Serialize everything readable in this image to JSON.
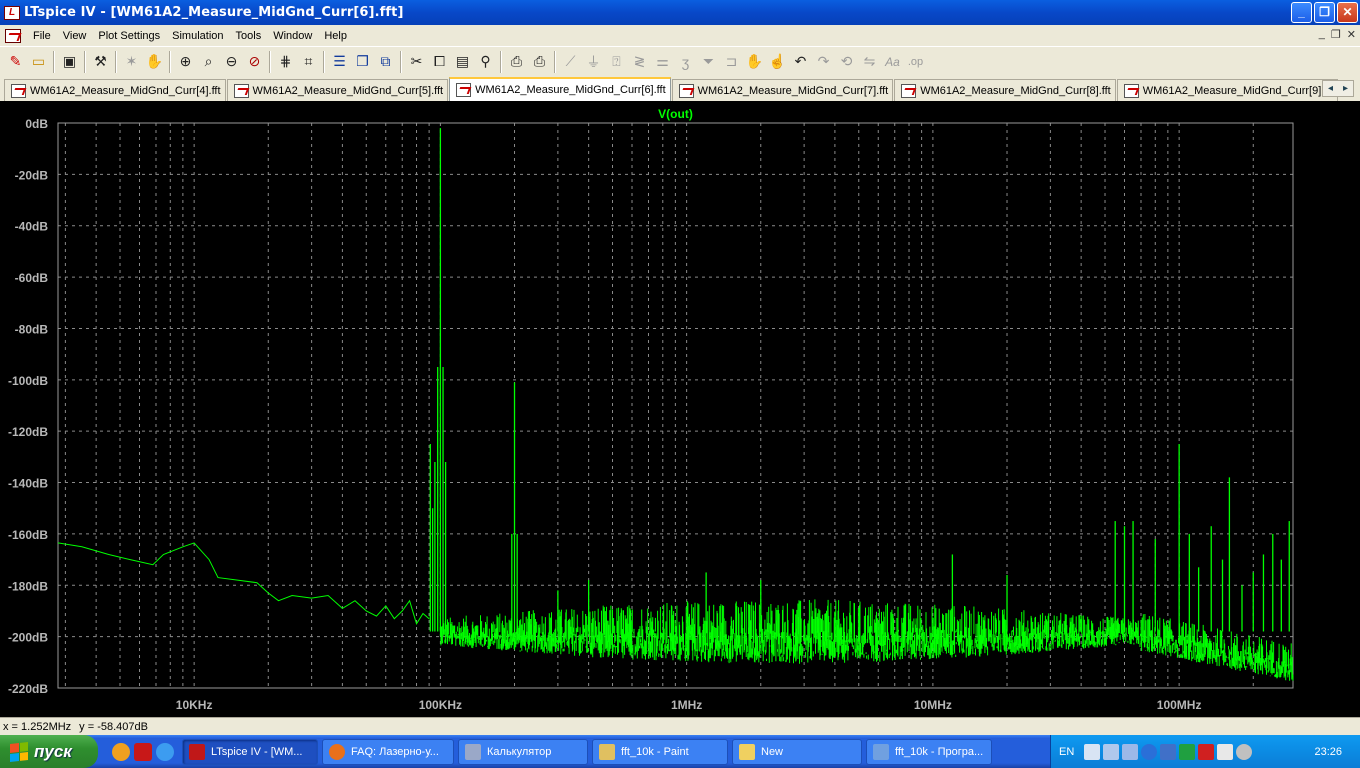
{
  "window": {
    "title": "LTspice IV - [WM61A2_Measure_MidGnd_Curr[6].fft]",
    "app_icon_glyph": "L",
    "buttons": {
      "minimize": "_",
      "restore": "❐",
      "close": "✕"
    }
  },
  "menu": {
    "items": [
      "File",
      "View",
      "Plot Settings",
      "Simulation",
      "Tools",
      "Window",
      "Help"
    ],
    "mdi_buttons": [
      "_",
      "❐",
      "✕"
    ]
  },
  "toolbar": {
    "icons": [
      "new-schematic-icon",
      "open-icon",
      "save-icon",
      "control-panel-icon",
      "run-icon",
      "halt-icon",
      "zoom-in-icon",
      "zoom-box-icon",
      "zoom-out-icon",
      "zoom-cancel-icon",
      "autorange-icon",
      "fit-icon",
      "tile-horizontal-icon",
      "cascade-icon",
      "tile-vertical-icon",
      "cut-icon",
      "copy-icon",
      "paste-icon",
      "find-icon",
      "print-preview-icon",
      "print-icon",
      "wire-icon",
      "ground-icon",
      "label-icon",
      "resistor-icon",
      "capacitor-icon",
      "inductor-icon",
      "diode-icon",
      "component-icon",
      "move-icon",
      "drag-icon",
      "undo-icon",
      "redo-icon",
      "rotate-icon",
      "mirror-icon",
      "text-icon",
      "spice-directive-icon"
    ]
  },
  "tabs": [
    {
      "label": "WM61A2_Measure_MidGnd_Curr[4].fft",
      "active": false
    },
    {
      "label": "WM61A2_Measure_MidGnd_Curr[5].fft",
      "active": false
    },
    {
      "label": "WM61A2_Measure_MidGnd_Curr[6].fft",
      "active": true
    },
    {
      "label": "WM61A2_Measure_MidGnd_Curr[7].fft",
      "active": false
    },
    {
      "label": "WM61A2_Measure_MidGnd_Curr[8].fft",
      "active": false
    },
    {
      "label": "WM61A2_Measure_MidGnd_Curr[9].fft",
      "active": false
    }
  ],
  "tab_scroll": {
    "left": "◂",
    "right": "▸"
  },
  "chart_data": {
    "type": "line",
    "title": "V(out)",
    "xlabel": "",
    "ylabel": "",
    "x_scale": "log",
    "xlim_hz": [
      2800,
      290000000
    ],
    "ylim": [
      -220,
      0
    ],
    "x_ticks": [
      {
        "value": 10000,
        "label": "10KHz"
      },
      {
        "value": 100000,
        "label": "100KHz"
      },
      {
        "value": 1000000,
        "label": "1MHz"
      },
      {
        "value": 10000000,
        "label": "10MHz"
      },
      {
        "value": 100000000,
        "label": "100MHz"
      }
    ],
    "y_ticks": [
      {
        "value": 0,
        "label": "0dB"
      },
      {
        "value": -20,
        "label": "-20dB"
      },
      {
        "value": -40,
        "label": "-40dB"
      },
      {
        "value": -60,
        "label": "-60dB"
      },
      {
        "value": -80,
        "label": "-80dB"
      },
      {
        "value": -100,
        "label": "-100dB"
      },
      {
        "value": -120,
        "label": "-120dB"
      },
      {
        "value": -140,
        "label": "-140dB"
      },
      {
        "value": -160,
        "label": "-160dB"
      },
      {
        "value": -180,
        "label": "-180dB"
      },
      {
        "value": -200,
        "label": "-200dB"
      },
      {
        "value": -220,
        "label": "-220dB"
      }
    ],
    "grid": true,
    "colors": {
      "trace": "#00ff00",
      "grid": "#8a8a8a",
      "axis_text": "#b8b8b8",
      "title": "#00ff00",
      "background": "#000000"
    },
    "series": [
      {
        "name": "V(out)",
        "points": [
          [
            2800,
            -163.5
          ],
          [
            3500,
            -165
          ],
          [
            4500,
            -168
          ],
          [
            5500,
            -170
          ],
          [
            6800,
            -172
          ],
          [
            7500,
            -168
          ],
          [
            9000,
            -165
          ],
          [
            10000,
            -163.5
          ],
          [
            11500,
            -170
          ],
          [
            12500,
            -177
          ],
          [
            15000,
            -178
          ],
          [
            18000,
            -179
          ],
          [
            20000,
            -183
          ],
          [
            22000,
            -186
          ],
          [
            25000,
            -184
          ],
          [
            30000,
            -185
          ],
          [
            35000,
            -184
          ],
          [
            40000,
            -189
          ],
          [
            45000,
            -186
          ],
          [
            50000,
            -190
          ],
          [
            55000,
            -192
          ],
          [
            60000,
            -188
          ],
          [
            65000,
            -193
          ],
          [
            70000,
            -190
          ],
          [
            75000,
            -186
          ],
          [
            80000,
            -195
          ],
          [
            85000,
            -191
          ],
          [
            90000,
            -193
          ]
        ],
        "spikes": [
          {
            "x": 91000,
            "y": -125
          },
          {
            "x": 93000,
            "y": -150
          },
          {
            "x": 95000,
            "y": -132
          },
          {
            "x": 97500,
            "y": -95
          },
          {
            "x": 100000,
            "y": -2
          },
          {
            "x": 102500,
            "y": -95
          },
          {
            "x": 105000,
            "y": -132
          },
          {
            "x": 195000,
            "y": -160
          },
          {
            "x": 200000,
            "y": -101
          },
          {
            "x": 205000,
            "y": -160
          },
          {
            "x": 300000,
            "y": -182
          },
          {
            "x": 400000,
            "y": -178
          },
          {
            "x": 1200000,
            "y": -175
          },
          {
            "x": 2000000,
            "y": -178
          },
          {
            "x": 12000000,
            "y": -168
          },
          {
            "x": 20000000,
            "y": -176
          },
          {
            "x": 55000000,
            "y": -155
          },
          {
            "x": 60000000,
            "y": -157
          },
          {
            "x": 65000000,
            "y": -155
          },
          {
            "x": 80000000,
            "y": -162
          },
          {
            "x": 100000000,
            "y": -125
          },
          {
            "x": 110000000,
            "y": -160
          },
          {
            "x": 120000000,
            "y": -173
          },
          {
            "x": 135000000,
            "y": -157
          },
          {
            "x": 150000000,
            "y": -170
          },
          {
            "x": 160000000,
            "y": -138
          },
          {
            "x": 180000000,
            "y": -180
          },
          {
            "x": 200000000,
            "y": -175
          },
          {
            "x": 220000000,
            "y": -168
          },
          {
            "x": 240000000,
            "y": -160
          },
          {
            "x": 260000000,
            "y": -170
          },
          {
            "x": 280000000,
            "y": -155
          }
        ],
        "noise_floor": {
          "x_start": 100000,
          "x_end": 290000000,
          "mean_db": -198,
          "spread_db": 9
        }
      }
    ]
  },
  "status": {
    "x_readout": "x = 1.252MHz",
    "y_readout": "y = -58.407dB"
  },
  "taskbar": {
    "start_label": "пуск",
    "tasks": [
      {
        "label": "LTspice IV - [WM...",
        "active": true,
        "color": "#c01818"
      },
      {
        "label": "FAQ: Лазерно-у...",
        "active": false,
        "color": "#e8701c"
      },
      {
        "label": "Калькулятор",
        "active": false,
        "color": "#9aa8c8"
      },
      {
        "label": "fft_10k - Paint",
        "active": false,
        "color": "#e0c060"
      },
      {
        "label": "New",
        "active": false,
        "color": "#f0d060"
      },
      {
        "label": "fft_10k - Програ...",
        "active": false,
        "color": "#70a0e0"
      }
    ],
    "tray": {
      "language": "EN",
      "clock": "23:26"
    }
  }
}
